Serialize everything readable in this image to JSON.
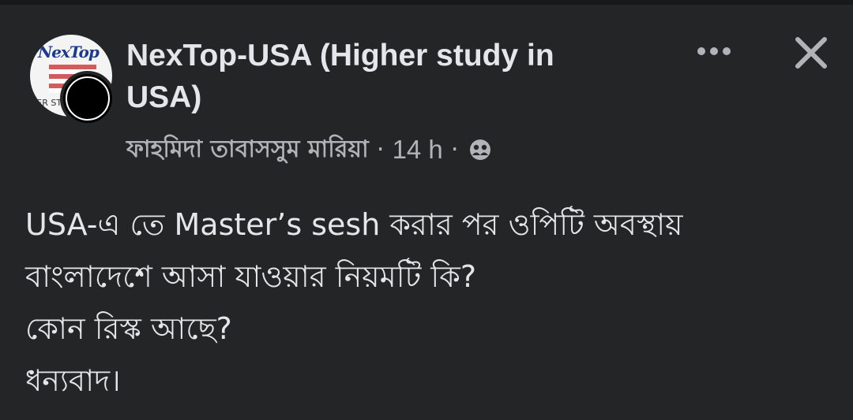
{
  "post": {
    "group_name": "NexTop-USA (Higher study in USA)",
    "author": "ফাহমিদা তাবাসসুম মারিয়া",
    "separator": "·",
    "time": "14 h",
    "audience_icon": "group-icon",
    "more_icon": "more-options-icon",
    "close_icon": "close-icon",
    "avatar": {
      "logo_text": "NexTop",
      "logo_tag": "HER ST"
    },
    "body_lines": [
      "USA-এ তে  Master’s sesh করার পর ওপিটি অবস্থায়",
      "বাংলাদেশে আসা যাওয়ার নিয়মটি কি?",
      "কোন রিস্ক আছে?",
      "ধন্যবাদ।"
    ]
  },
  "colors": {
    "background": "#242526",
    "text_primary": "#e4e6eb",
    "text_secondary": "#b0b3b8"
  }
}
